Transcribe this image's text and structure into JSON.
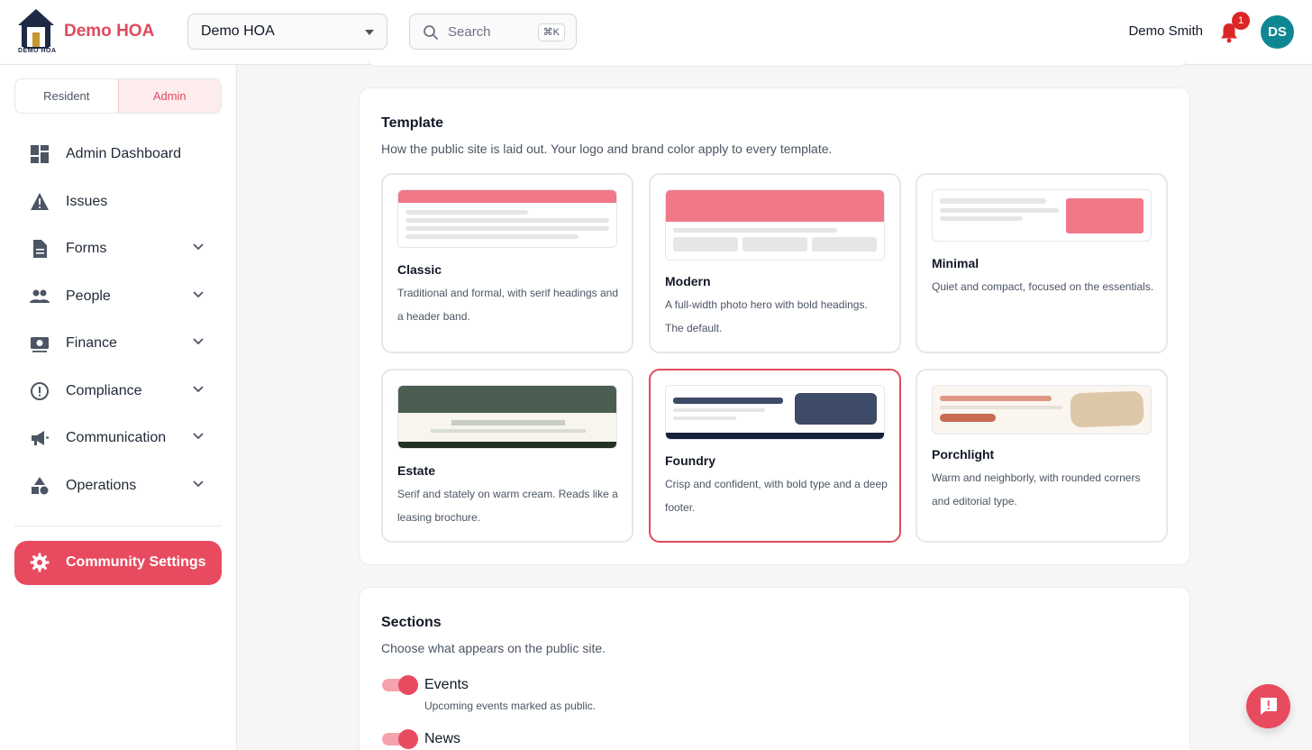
{
  "brand": {
    "name": "Demo HOA",
    "logo_caption": "DEMO HOA",
    "accent": "#e04a5f"
  },
  "header": {
    "hoa_select": "Demo HOA",
    "search_placeholder": "Search",
    "search_shortcut": "⌘K",
    "user_name": "Demo Smith",
    "notification_count": "1",
    "avatar_initials": "DS"
  },
  "sidebar": {
    "roles": [
      "Resident",
      "Admin"
    ],
    "active_role": "Admin",
    "items": [
      {
        "label": "Admin Dashboard",
        "icon": "dashboard-icon"
      },
      {
        "label": "Issues",
        "icon": "warning-icon"
      },
      {
        "label": "Forms",
        "icon": "document-icon"
      },
      {
        "label": "People",
        "icon": "people-icon"
      },
      {
        "label": "Finance",
        "icon": "money-icon"
      },
      {
        "label": "Compliance",
        "icon": "alert-circle-icon"
      },
      {
        "label": "Communication",
        "icon": "megaphone-icon"
      },
      {
        "label": "Operations",
        "icon": "shapes-icon"
      }
    ],
    "active_item": "Community Settings"
  },
  "template_card": {
    "title": "Template",
    "description": "How the public site is laid out. Your logo and brand color apply to every template.",
    "templates": [
      {
        "name": "Classic",
        "description": "Traditional and formal, with serif headings and a header band."
      },
      {
        "name": "Modern",
        "description": "A full-width photo hero with bold headings. The default."
      },
      {
        "name": "Minimal",
        "description": "Quiet and compact, focused on the essentials."
      },
      {
        "name": "Estate",
        "description": "Serif and stately on warm cream. Reads like a leasing brochure."
      },
      {
        "name": "Foundry",
        "description": "Crisp and confident, with bold type and a deep footer."
      },
      {
        "name": "Porchlight",
        "description": "Warm and neighborly, with rounded corners and editorial type."
      }
    ],
    "selected": "Foundry"
  },
  "sections_card": {
    "title": "Sections",
    "description": "Choose what appears on the public site.",
    "sections": [
      {
        "label": "Events",
        "description": "Upcoming events marked as public.",
        "enabled": true
      },
      {
        "label": "News",
        "description": "",
        "enabled": true
      }
    ]
  }
}
